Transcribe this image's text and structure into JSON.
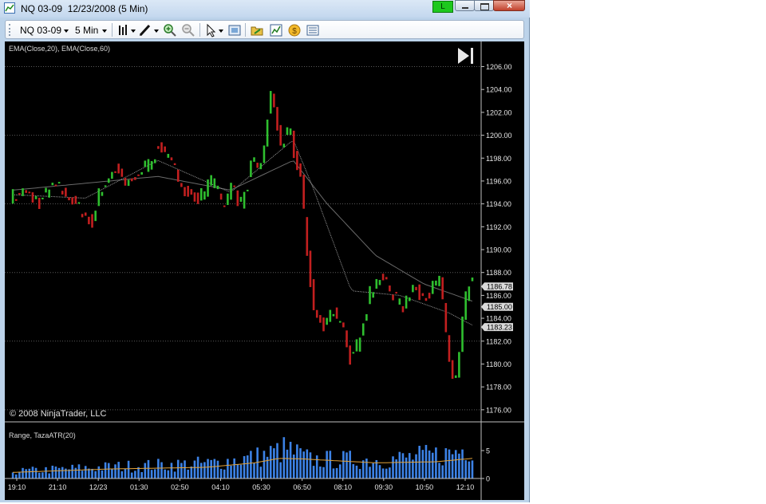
{
  "window": {
    "title": "NQ 03-09  12/23/2008 (5 Min)",
    "status_label": "L",
    "buttons": [
      "minimize-icon",
      "maximize-icon",
      "close-icon"
    ]
  },
  "toolbar": {
    "instrument": "NQ 03-09",
    "interval": "5 Min",
    "icons": [
      "bar-style-icon",
      "drawing-pencil-icon",
      "zoom-in-icon",
      "zoom-out-icon",
      "cursor-pointer-icon",
      "data-box-icon",
      "properties-folder-icon",
      "indicators-icon",
      "strategies-coin-icon",
      "chart-trader-icon"
    ]
  },
  "colors": {
    "background": "#000000",
    "up_bar": "#2fbf2f",
    "down_bar": "#c21f1f",
    "volume_bar": "#3c82e6",
    "atr_line": "#e3a33a",
    "ema_fast": "#9a9a9a",
    "ema_slow": "#6a6a6a"
  },
  "chart_data": [
    {
      "type": "candlestick",
      "title": "",
      "indicator_label": "EMA(Close,20), EMA(Close,60)",
      "copyright": "© 2008 NinjaTrader, LLC",
      "ylim": [
        1175.5,
        1207.5
      ],
      "y_ticks": [
        "1206.00",
        "1204.00",
        "1202.00",
        "1200.00",
        "1198.00",
        "1196.00",
        "1194.00",
        "1192.00",
        "1190.00",
        "1188.00",
        "1186.00",
        "1184.00",
        "1182.00",
        "1180.00",
        "1178.00",
        "1176.00"
      ],
      "price_markers": [
        "1186.78",
        "1185.00",
        "1183.23"
      ],
      "grid": "dotted horizontal lines at 1206, 1200, 1194, 1188, 1182, 1176",
      "bars_count": 140,
      "price_path": [
        [
          0,
          1194.5
        ],
        [
          6,
          1195
        ],
        [
          12,
          1194.2
        ],
        [
          18,
          1195.6
        ],
        [
          24,
          1194.8
        ],
        [
          30,
          1193.2
        ],
        [
          34,
          1192.5
        ],
        [
          38,
          1195.5
        ],
        [
          44,
          1197.2
        ],
        [
          48,
          1195.5
        ],
        [
          52,
          1196.5
        ],
        [
          58,
          1197.5
        ],
        [
          62,
          1199.5
        ],
        [
          66,
          1197.5
        ],
        [
          70,
          1196.2
        ],
        [
          74,
          1195
        ],
        [
          78,
          1194.4
        ],
        [
          84,
          1196
        ],
        [
          88,
          1193.8
        ],
        [
          92,
          1195.6
        ],
        [
          96,
          1193.8
        ],
        [
          100,
          1197.4
        ],
        [
          104,
          1197.2
        ],
        [
          108,
          1203.8
        ],
        [
          112,
          1199.2
        ],
        [
          116,
          1200.2
        ],
        [
          118,
          1198
        ],
        [
          120,
          1197
        ],
        [
          122,
          1192
        ],
        [
          124,
          1188
        ],
        [
          126,
          1184.2
        ],
        [
          130,
          1183.6
        ],
        [
          134,
          1184.8
        ],
        [
          138,
          1182.6
        ],
        [
          140,
          1180.6
        ],
        [
          143,
          1181
        ],
        [
          146,
          1184
        ],
        [
          150,
          1186.8
        ],
        [
          154,
          1187.6
        ],
        [
          158,
          1186.2
        ],
        [
          162,
          1184.8
        ],
        [
          166,
          1186.8
        ],
        [
          170,
          1186.2
        ],
        [
          174,
          1186.4
        ],
        [
          178,
          1187.2
        ],
        [
          180,
          1183.4
        ],
        [
          182,
          1180
        ],
        [
          184,
          1177.8
        ],
        [
          186,
          1181
        ],
        [
          188,
          1185
        ],
        [
          190,
          1186.8
        ]
      ],
      "ema_20_path": [
        [
          0,
          1194.8
        ],
        [
          30,
          1194.5
        ],
        [
          60,
          1197.8
        ],
        [
          90,
          1195
        ],
        [
          108,
          1198.2
        ],
        [
          116,
          1199.6
        ],
        [
          124,
          1195.5
        ],
        [
          140,
          1186.4
        ],
        [
          160,
          1186
        ],
        [
          180,
          1184.5
        ],
        [
          190,
          1183.4
        ]
      ],
      "ema_60_path": [
        [
          0,
          1195.2
        ],
        [
          60,
          1196.4
        ],
        [
          90,
          1195.2
        ],
        [
          116,
          1197.8
        ],
        [
          130,
          1194
        ],
        [
          150,
          1189.5
        ],
        [
          170,
          1187
        ],
        [
          190,
          1185.5
        ]
      ]
    },
    {
      "type": "bar",
      "indicator_label": "Range, TazaATR(20)",
      "ylim": [
        0,
        9
      ],
      "y_ticks": [
        "5",
        "0"
      ],
      "x_tick_labels": [
        "19:10",
        "21:10",
        "12/23",
        "01:30",
        "02:50",
        "04:10",
        "05:30",
        "06:50",
        "08:10",
        "09:30",
        "10:50",
        "12:10"
      ],
      "volume_path": [
        [
          0,
          1.2
        ],
        [
          40,
          2
        ],
        [
          80,
          2.6
        ],
        [
          100,
          3.8
        ],
        [
          110,
          5
        ],
        [
          120,
          3.2
        ],
        [
          150,
          3.2
        ],
        [
          175,
          4.2
        ],
        [
          185,
          5.5
        ]
      ],
      "atr_path": [
        [
          0,
          1.1
        ],
        [
          40,
          1.7
        ],
        [
          80,
          2
        ],
        [
          100,
          2.8
        ],
        [
          110,
          3.6
        ],
        [
          120,
          3.5
        ],
        [
          150,
          2.8
        ],
        [
          175,
          3
        ],
        [
          190,
          3.6
        ]
      ]
    }
  ]
}
